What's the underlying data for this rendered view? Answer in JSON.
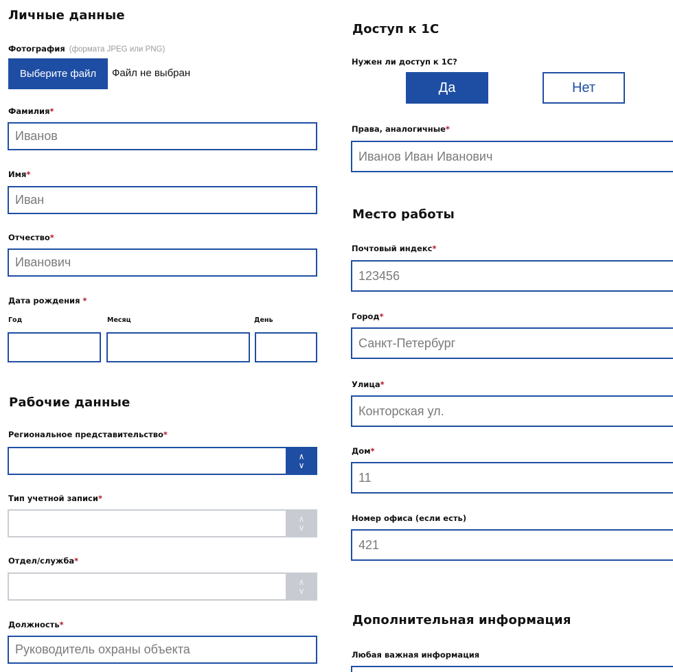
{
  "personal": {
    "title": "Личные данные",
    "photo_label": "Фотография",
    "photo_hint": "(формата JPEG или PNG)",
    "choose_file": "Выберите файл",
    "no_file": "Файл не выбран",
    "surname_label": "Фамилия",
    "surname_value": "Иванов",
    "name_label": "Имя",
    "name_value": "Иван",
    "patronymic_label": "Отчество",
    "patronymic_value": "Иванович",
    "birth_label": "Дата рождения ",
    "year_label": "Год",
    "month_label": "Месяц",
    "day_label": "День",
    "required_mark": "*"
  },
  "work": {
    "title": "Рабочие данные",
    "region_label": "Региональное представительство",
    "account_type_label": "Тип учетной записи",
    "department_label": "Отдел/служба",
    "position_label": "Должность",
    "position_value": "Руководитель охраны объекта"
  },
  "access": {
    "title": "Доступ к 1С",
    "question": "Нужен ли доступ к 1С?",
    "yes": "Да",
    "no": "Нет",
    "rights_label": "Права, аналогичные",
    "rights_value": "Иванов Иван Иванович"
  },
  "workplace": {
    "title": "Место работы",
    "postal_label": "Почтовый индекс",
    "postal_value": "123456",
    "city_label": "Город",
    "city_value": "Санкт-Петербург",
    "street_label": "Улица",
    "street_value": "Конторская ул.",
    "house_label": "Дом",
    "house_value": "11",
    "office_label": "Номер офиса (если есть)",
    "office_value": "421"
  },
  "extra": {
    "title": "Дополнительная информация",
    "info_label": "Любая важная информация"
  },
  "icons": {
    "up": "∧",
    "down": "∨"
  },
  "colors": {
    "accent": "#1e4ea3",
    "required": "#b0182b",
    "disabled": "#c8ccd2"
  }
}
